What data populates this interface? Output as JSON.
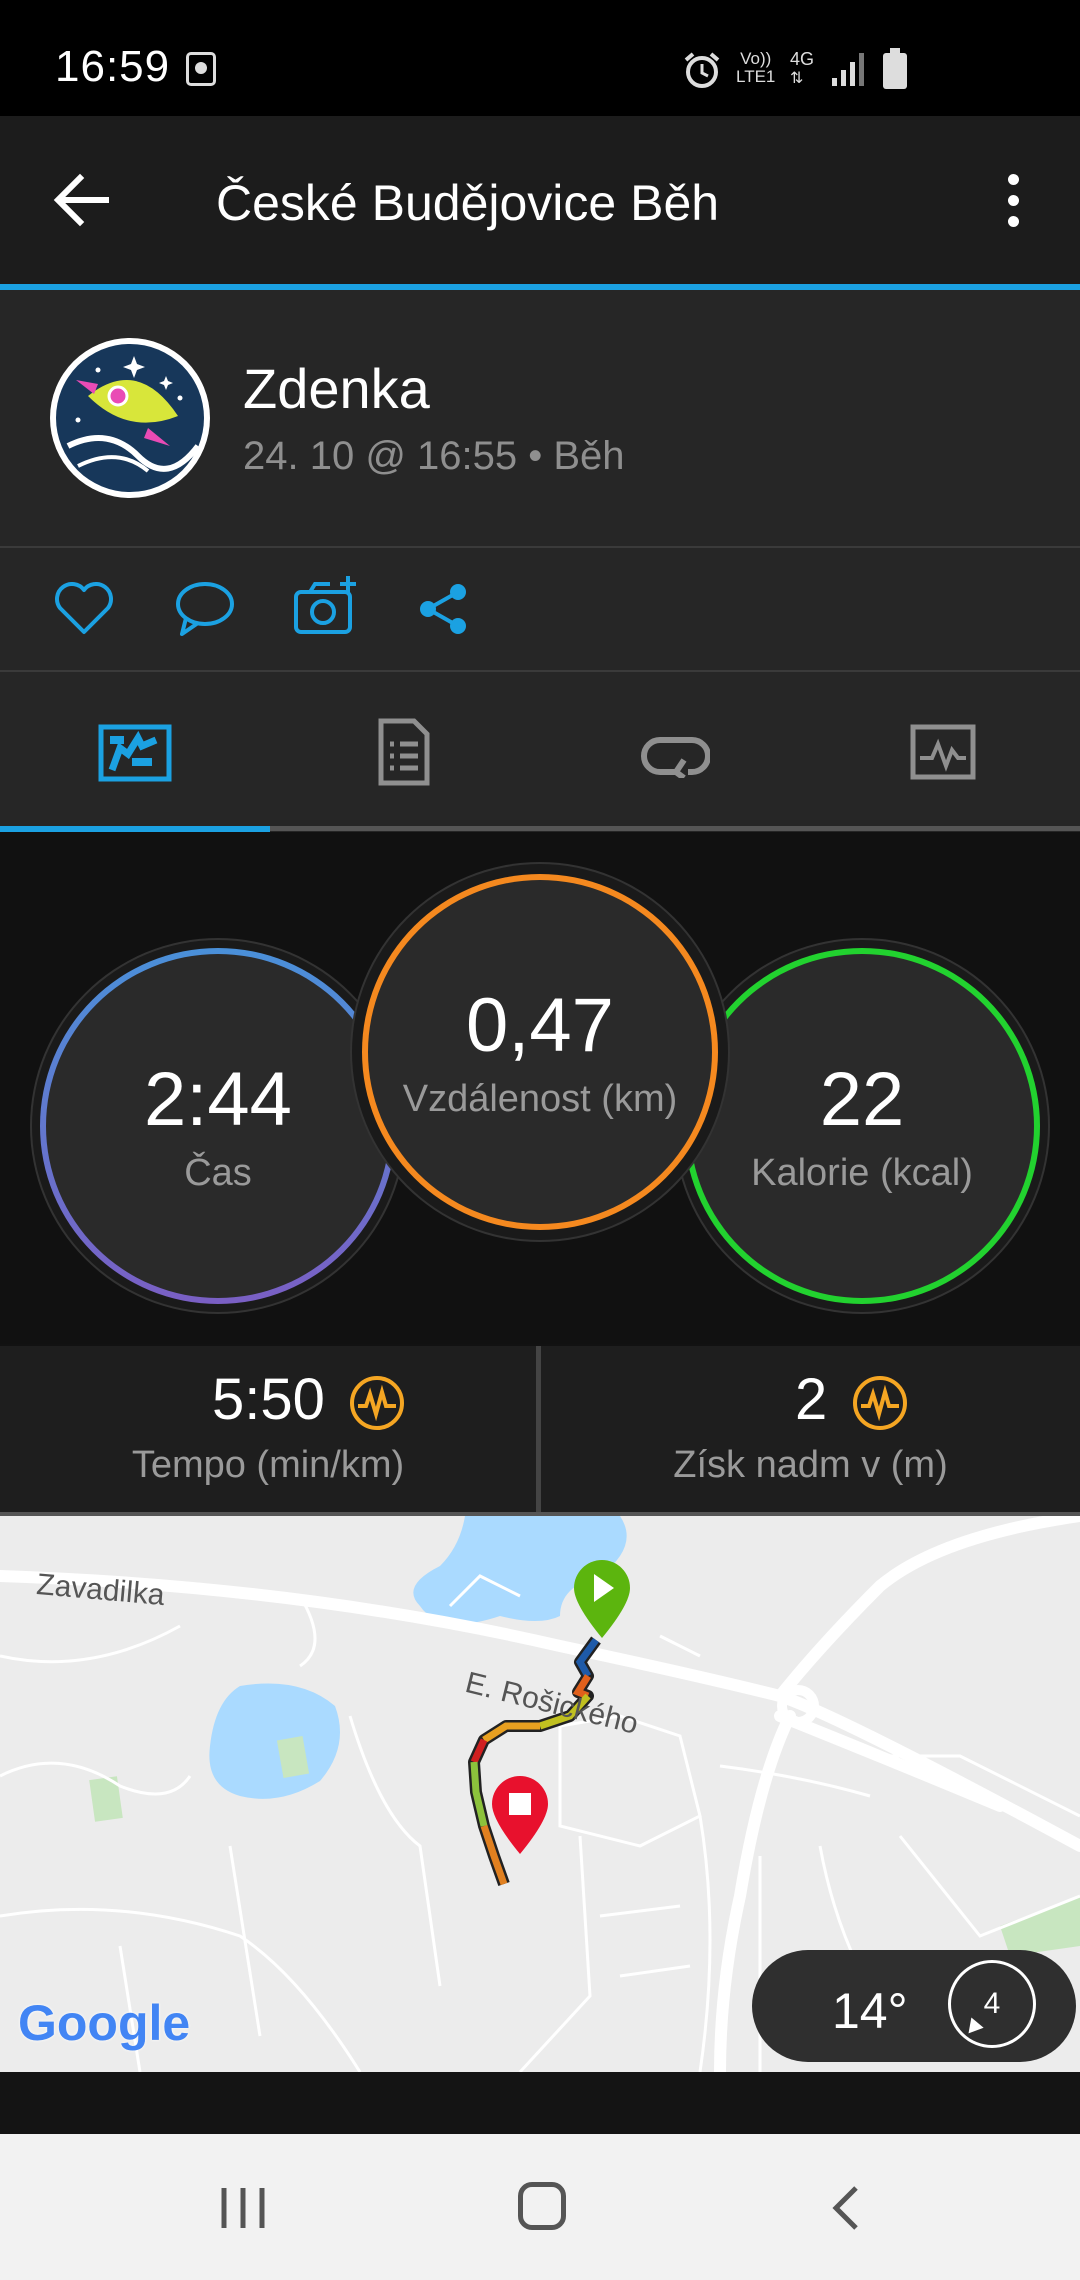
{
  "status_bar": {
    "time": "16:59",
    "network_volte": "Vo))",
    "network_lte": "LTE1",
    "network_4g": "4G"
  },
  "app_bar": {
    "title": "České Budějovice Běh"
  },
  "profile": {
    "name": "Zdenka",
    "meta": "24. 10 @ 16:55 • Běh"
  },
  "stats": {
    "time_value": "2:44",
    "time_label": "Čas",
    "distance_value": "0,47",
    "distance_label": "Vzdálenost (km)",
    "calories_value": "22",
    "calories_label": "Kalorie (kcal)"
  },
  "secondary_stats": {
    "pace_value": "5:50",
    "pace_label": "Tempo (min/km)",
    "elevation_value": "2",
    "elevation_label": "Získ nadm v (m)"
  },
  "map": {
    "street_1": "Zavadilka",
    "street_2": "E. Rošického",
    "google_logo": "Google",
    "weather_temp": "14°",
    "wind_speed": "4"
  },
  "colors": {
    "accent": "#1ba1e2",
    "time_ring": "#4a90d9",
    "distance_ring": "#f5891f",
    "calories_ring": "#22d22f",
    "badge_orange": "#f5a623",
    "start_pin": "#5cb50e",
    "end_pin": "#e8112d"
  }
}
